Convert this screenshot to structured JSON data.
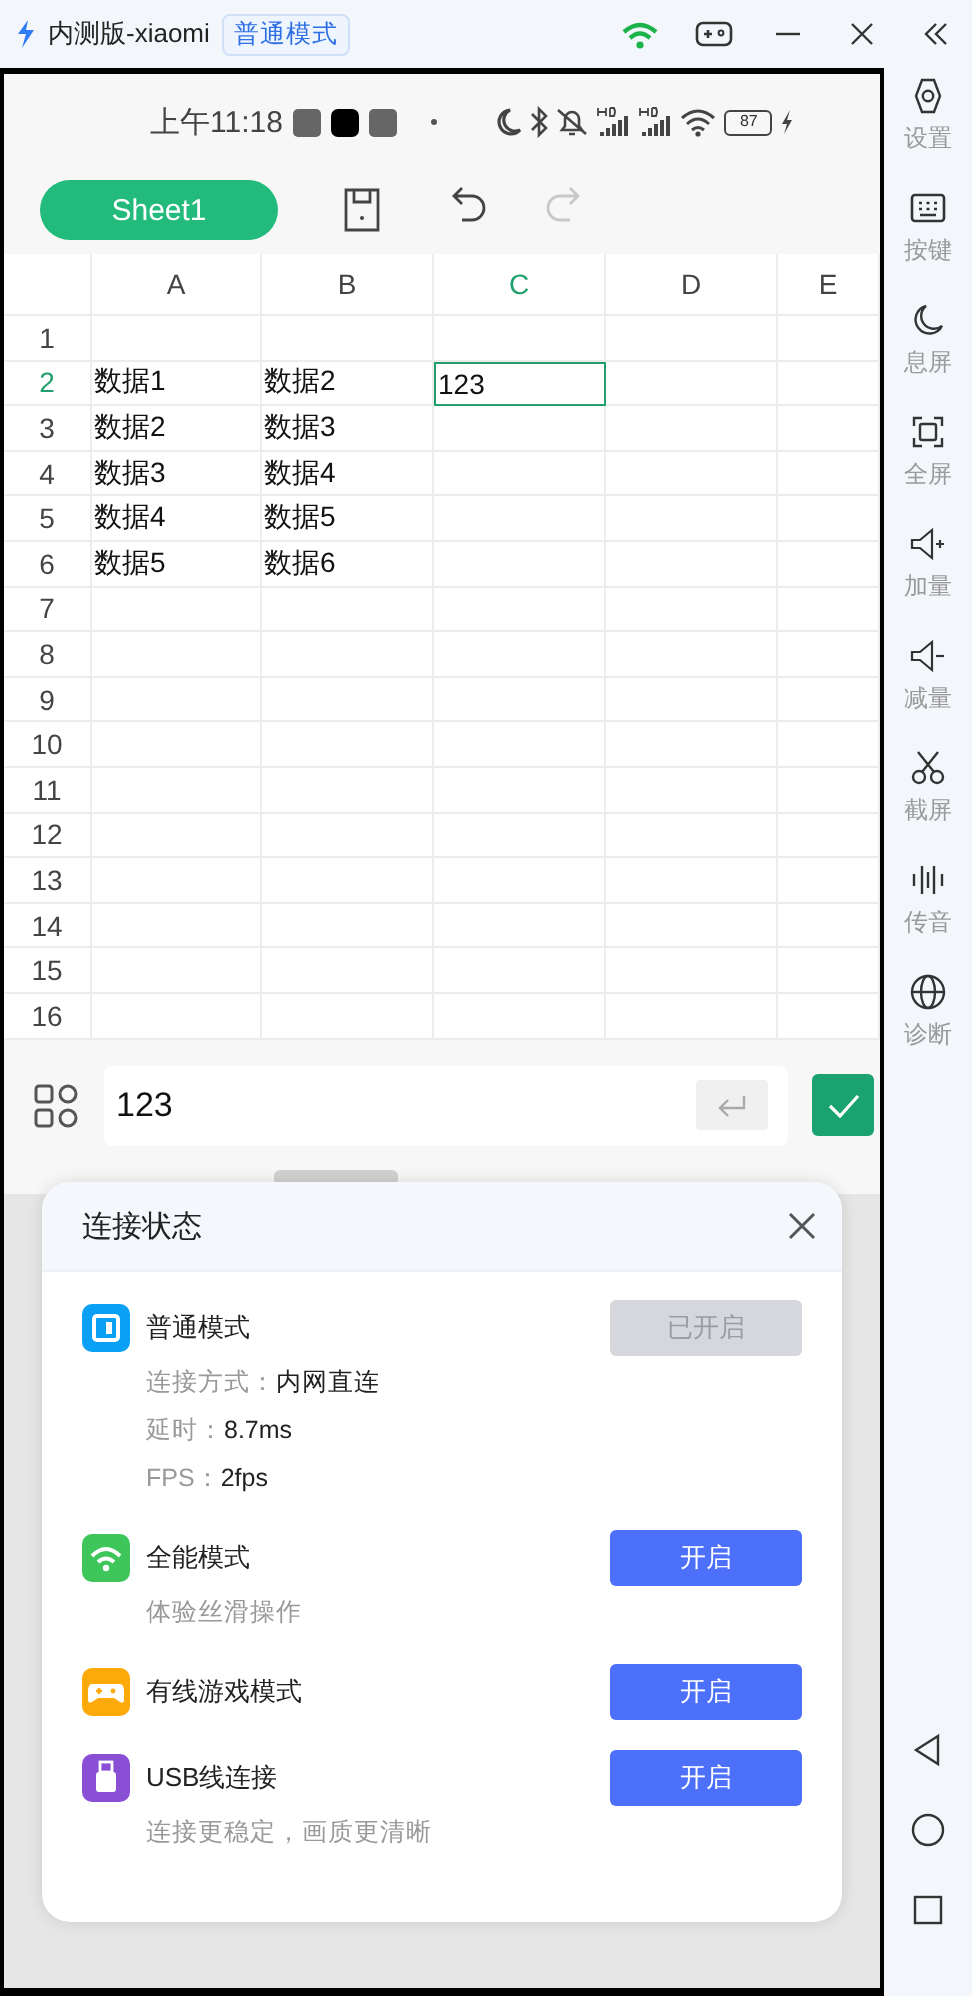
{
  "title_bar": {
    "app_name": "内测版-xiaomi",
    "mode_badge": "普通模式"
  },
  "sidebar": {
    "items": [
      {
        "label": "设置"
      },
      {
        "label": "按键"
      },
      {
        "label": "息屏"
      },
      {
        "label": "全屏"
      },
      {
        "label": "加量"
      },
      {
        "label": "减量"
      },
      {
        "label": "截屏"
      },
      {
        "label": "传音"
      },
      {
        "label": "诊断"
      }
    ]
  },
  "status_bar": {
    "time": "上午11:18",
    "battery": "87"
  },
  "toolbar": {
    "sheet_tab": "Sheet1"
  },
  "sheet": {
    "columns": [
      {
        "label": "A",
        "selected": false
      },
      {
        "label": "B",
        "selected": false
      },
      {
        "label": "C",
        "selected": true
      },
      {
        "label": "D",
        "selected": false
      },
      {
        "label": "E",
        "selected": false
      }
    ],
    "rows": [
      {
        "number": "1",
        "selected": false,
        "cells": []
      },
      {
        "number": "2",
        "selected": true,
        "cells": [
          {
            "value": "数据1",
            "selected": false
          },
          {
            "value": "数据2",
            "selected": false
          },
          {
            "value": "123",
            "selected": true
          }
        ]
      },
      {
        "number": "3",
        "selected": false,
        "cells": [
          {
            "value": "数据2",
            "selected": false
          },
          {
            "value": "数据3",
            "selected": false
          }
        ]
      },
      {
        "number": "4",
        "selected": false,
        "cells": [
          {
            "value": "数据3",
            "selected": false
          },
          {
            "value": "数据4",
            "selected": false
          }
        ]
      },
      {
        "number": "5",
        "selected": false,
        "cells": [
          {
            "value": "数据4",
            "selected": false
          },
          {
            "value": "数据5",
            "selected": false
          }
        ]
      },
      {
        "number": "6",
        "selected": false,
        "cells": [
          {
            "value": "数据5",
            "selected": false
          },
          {
            "value": "数据6",
            "selected": false
          }
        ]
      },
      {
        "number": "7",
        "selected": false,
        "cells": []
      },
      {
        "number": "8",
        "selected": false,
        "cells": []
      },
      {
        "number": "9",
        "selected": false,
        "cells": []
      },
      {
        "number": "10",
        "selected": false,
        "cells": []
      },
      {
        "number": "11",
        "selected": false,
        "cells": []
      },
      {
        "number": "12",
        "selected": false,
        "cells": []
      },
      {
        "number": "13",
        "selected": false,
        "cells": []
      },
      {
        "number": "14",
        "selected": false,
        "cells": []
      },
      {
        "number": "15",
        "selected": false,
        "cells": []
      },
      {
        "number": "16",
        "selected": false,
        "cells": []
      }
    ]
  },
  "formula_bar": {
    "value": "123"
  },
  "dialog": {
    "title": "连接状态",
    "modes": [
      {
        "kind": "normal",
        "name": "普通模式",
        "button": "已开启",
        "disabled": true,
        "details": [
          {
            "label": "连接方式：",
            "value": "内网直连"
          },
          {
            "label": "延时：",
            "value": "8.7ms"
          },
          {
            "label": "FPS：",
            "value": "2fps"
          }
        ]
      },
      {
        "kind": "wifi",
        "name": "全能模式",
        "button": "开启",
        "disabled": false,
        "description": "体验丝滑操作"
      },
      {
        "kind": "game",
        "name": "有线游戏模式",
        "button": "开启",
        "disabled": false
      },
      {
        "kind": "usb",
        "name": "USB线连接",
        "button": "开启",
        "disabled": false,
        "description": "连接更稳定，画质更清晰"
      }
    ]
  }
}
